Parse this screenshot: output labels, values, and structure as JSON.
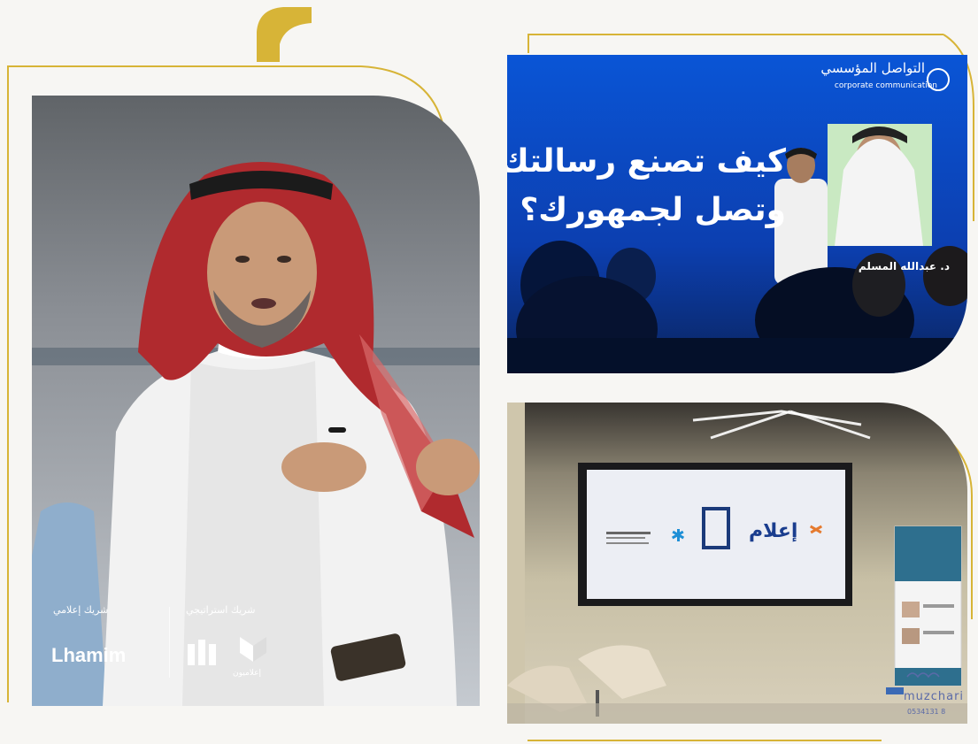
{
  "left_panel": {
    "media_partner_label": "شريك إعلامي",
    "strategic_partner_label": "شريك استراتيجي",
    "media_partner_logo_text": "Lhamim",
    "strategic_partner_logo_text": "إعلاميون"
  },
  "top_right_slide": {
    "title_line1": "كيف تصنع رسالتك",
    "title_line2": "وتصل لجمهورك؟",
    "brand_arabic": "التواصل المؤسسي",
    "brand_english": "corporate communication",
    "speaker_name": "د. عبدالله المسلم"
  },
  "bottom_right_screen": {
    "logo_text": "إعلام"
  },
  "watermark": {
    "name": "muzchari",
    "phone": "0534131 8"
  },
  "colors": {
    "gold_accent": "#d7b437",
    "slide_blue": "#0a55d6",
    "page_background": "#f7f6f3"
  }
}
